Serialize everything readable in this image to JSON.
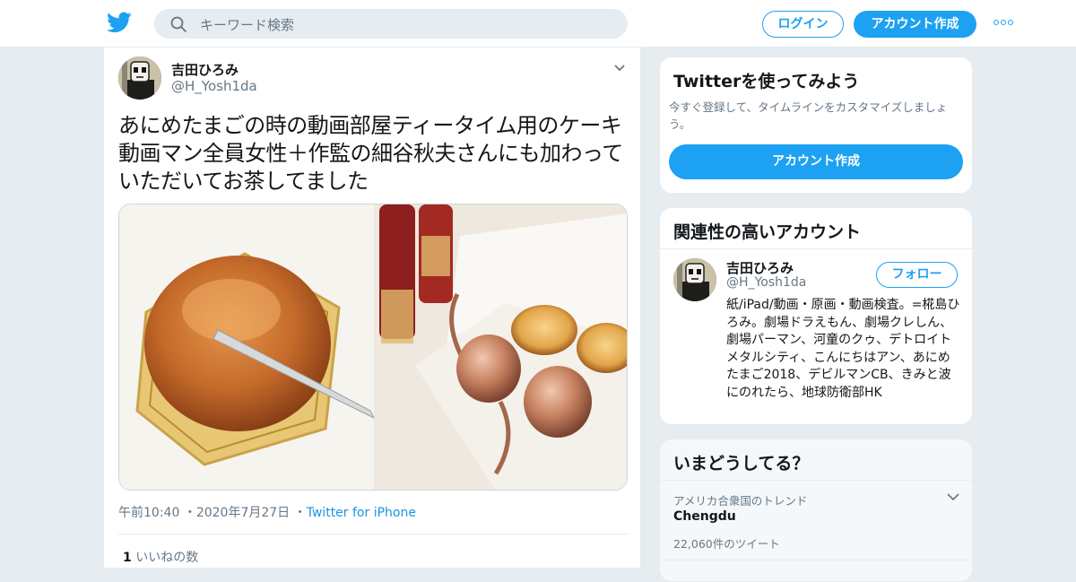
{
  "header": {
    "search_placeholder": "キーワード検索",
    "login_label": "ログイン",
    "signup_label": "アカウント作成",
    "brand_color": "#1da1f2"
  },
  "tweet": {
    "author_name": "吉田ひろみ",
    "author_handle": "@H_Yosh1da",
    "text": "あにめたまごの時の動画部屋ティータイム用のケーキ動画マン全員女性＋作監の細谷秋夫さんにも加わっていただいてお茶してました",
    "time": "午前10:40",
    "date": "2020年7月27日",
    "source": "Twitter for iPhone",
    "likes_count": "1",
    "likes_label": "いいねの数"
  },
  "sidebar": {
    "try_twitter": {
      "title": "Twitterを使ってみよう",
      "subtitle": "今すぐ登録して、タイムラインをカスタマイズしましょう。",
      "button_label": "アカウント作成"
    },
    "related": {
      "title": "関連性の高いアカウント",
      "account_name": "吉田ひろみ",
      "account_handle": "@H_Yosh1da",
      "follow_label": "フォロー",
      "bio": "紙/iPad/動画・原画・動画検査。=椛島ひろみ。劇場ドラえもん、劇場クレしん、劇場パーマン、河童のクゥ、デトロイトメタルシティ、こんにちはアン、あにめたまご2018、デビルマンCB、きみと波にのれたら、地球防衛部HK"
    },
    "trends": {
      "title": "いまどうしてる？",
      "context": "アメリカ合衆国のトレンド",
      "topic": "Chengdu",
      "count": "22,060件のツイート"
    }
  }
}
